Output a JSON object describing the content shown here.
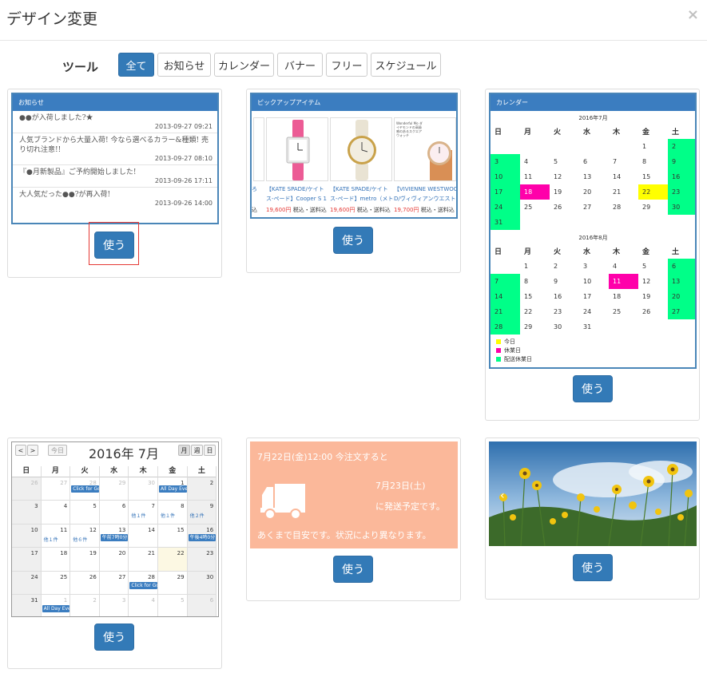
{
  "header": {
    "title": "デザイン変更",
    "close": "×"
  },
  "tools": {
    "label": "ツール",
    "filters": [
      "全て",
      "お知らせ",
      "カレンダー",
      "バナー",
      "フリー",
      "スケジュール"
    ],
    "active": "全て"
  },
  "use_label": "使う",
  "news": {
    "title": "お知らせ",
    "items": [
      {
        "text": "●●が入荷しました?★",
        "date": "2013-09-27 09:21"
      },
      {
        "text": "人気ブランドから大量入荷! 今なら選べるカラー&種類! 売り切れ注意!!",
        "date": "2013-09-27 08:10"
      },
      {
        "text": "『●月新製品』ご予約開始しました!",
        "date": "2013-09-26 17:11"
      },
      {
        "text": "大人気だった●●?が再入荷!",
        "date": "2013-09-26 14:00"
      }
    ]
  },
  "pickup": {
    "title": "ピックアップアイテム",
    "items": [
      {
        "name1": "【KATE SPADE/ケイト",
        "name2": "ス-ペード】Cooper S 1",
        "price": "19,600円",
        "tax": "税込・送料込"
      },
      {
        "name1": "【KATE SPADE/ケイト",
        "name2": "ス-ペード】metro（メト",
        "price": "19,600円",
        "tax": "税込・送料込"
      },
      {
        "name1": "【VIVIENNE WESTWOO",
        "name2": "D/ヴィヴィアンウエスト",
        "price": "19,700円",
        "tax": "税込・送料込"
      }
    ],
    "partial_left": {
      "name2": "ろ",
      "tax": "込"
    },
    "item_text": "Wonderful Mo ダイヤモンドの高級感のあるスクエアウォッチ"
  },
  "mini_calendar": {
    "title": "カレンダー",
    "weekdays": [
      "日",
      "月",
      "火",
      "水",
      "木",
      "金",
      "土"
    ],
    "months": [
      {
        "label": "2016年7月",
        "first_weekday": 5,
        "days": 31,
        "holiday": [
          2,
          3,
          9,
          10,
          16,
          17,
          23,
          24,
          30,
          31
        ],
        "holiday_red": [
          18
        ],
        "today": [
          22
        ]
      },
      {
        "label": "2016年8月",
        "first_weekday": 1,
        "days": 31,
        "holiday": [
          6,
          7,
          13,
          14,
          20,
          21,
          27,
          28
        ],
        "holiday_red": [
          11
        ],
        "today": []
      }
    ],
    "legend": [
      {
        "label": "今日",
        "color": "#ffff00"
      },
      {
        "label": "休業日",
        "color": "#ff00aa"
      },
      {
        "label": "配送休業日",
        "color": "#00ff88"
      }
    ]
  },
  "big_calendar": {
    "title": "2016年 7月",
    "today_btn": "今日",
    "prev": "<",
    "next": ">",
    "views": [
      "月",
      "週",
      "日"
    ],
    "weekdays": [
      "日",
      "月",
      "火",
      "水",
      "木",
      "金",
      "土"
    ],
    "weeks": [
      [
        "26",
        "27",
        "28",
        "29",
        "30",
        "1",
        "2"
      ],
      [
        "3",
        "4",
        "5",
        "6",
        "7",
        "8",
        "9"
      ],
      [
        "10",
        "11",
        "12",
        "13",
        "14",
        "15",
        "16"
      ],
      [
        "17",
        "18",
        "19",
        "20",
        "21",
        "22",
        "23"
      ],
      [
        "24",
        "25",
        "26",
        "27",
        "28",
        "29",
        "30"
      ],
      [
        "31",
        "1",
        "2",
        "3",
        "4",
        "5",
        "6"
      ]
    ],
    "events": {
      "e1": "Click for Go",
      "e2": "All Day Eve",
      "e3": "他１件",
      "e4": "他１件",
      "e5": "他２件",
      "e6": "他１件",
      "e7": "他６件",
      "e8": "午前7時0分",
      "e9": "午後4時0分",
      "e10": "Click for Go",
      "e11": "All Day Eve"
    }
  },
  "shipping": {
    "line1": "7月22日(金)12:00 今注文すると",
    "line2": "7月23日(土)",
    "line3": "に発送予定です。",
    "line4": "あくまで目安です。状況により異なります。"
  },
  "colors": {
    "primary": "#337ab7",
    "ship_bg": "#fbb89a",
    "cal_green": "#00ff88",
    "cal_magenta": "#ff00aa",
    "cal_yellow": "#ffff00"
  }
}
